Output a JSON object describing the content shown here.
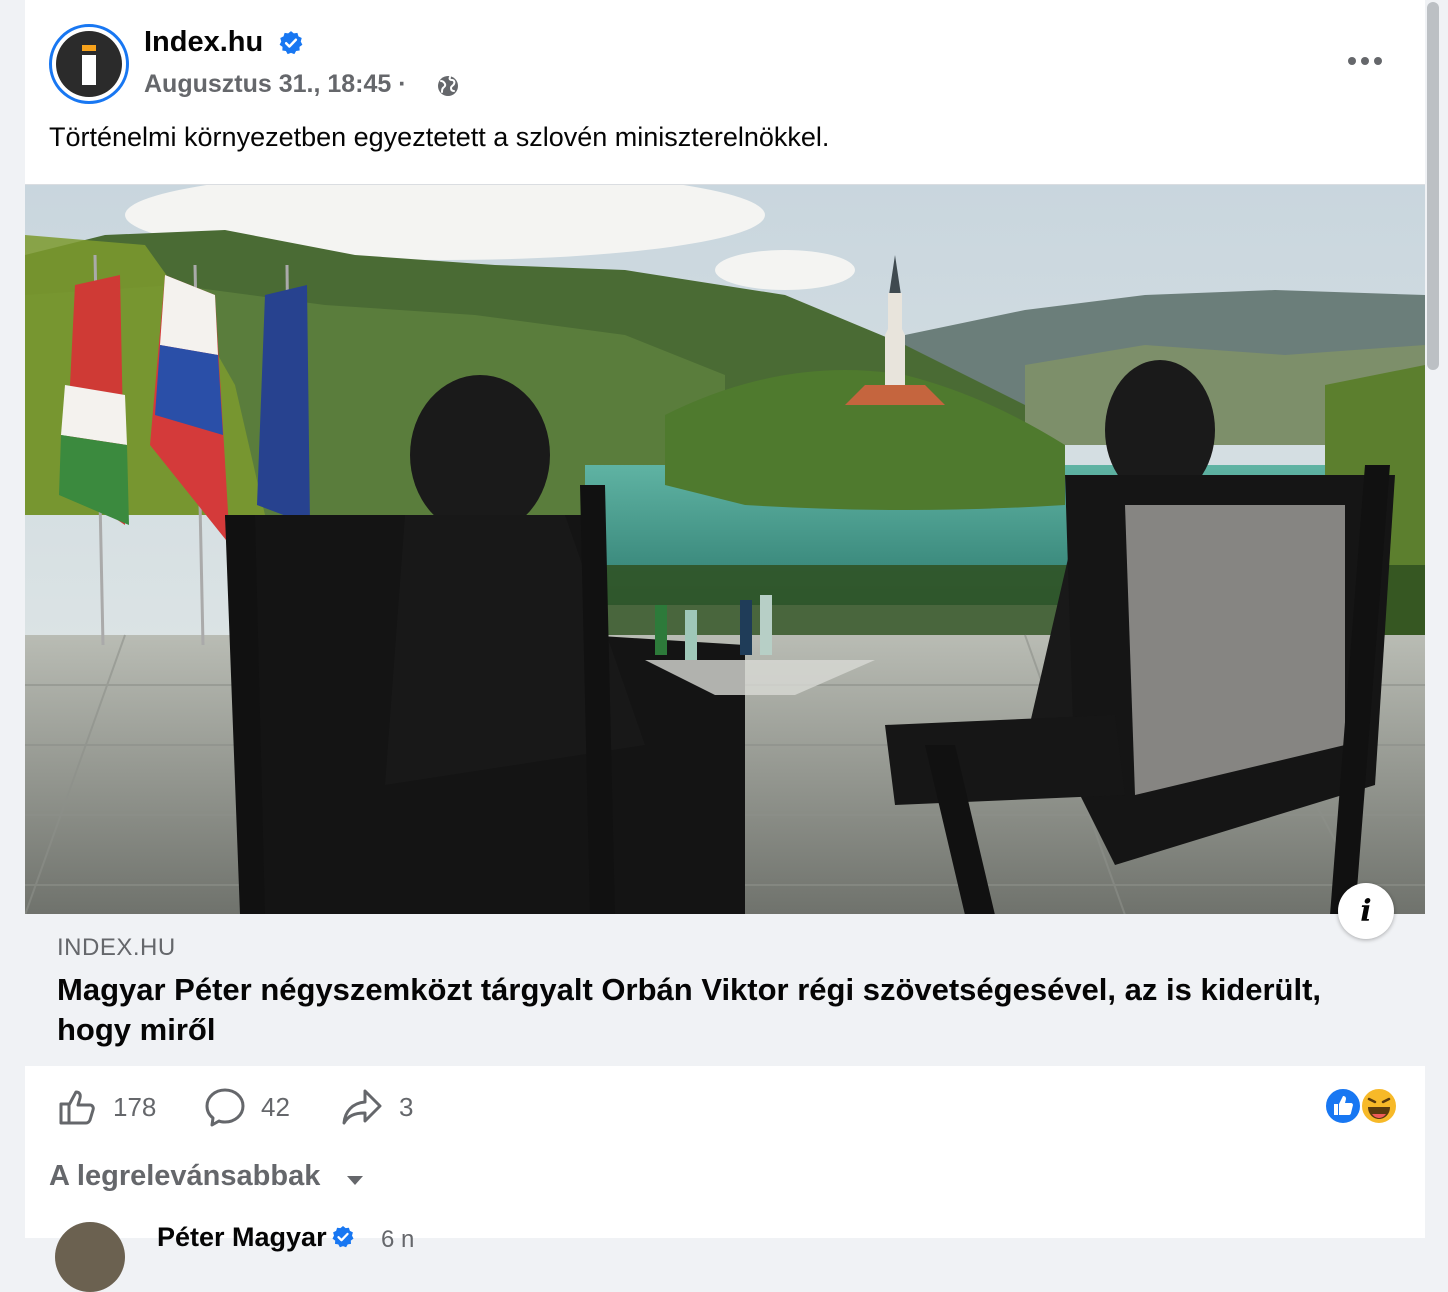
{
  "post": {
    "page_name": "Index.hu",
    "timestamp": "Augusztus 31., 18:45",
    "separator": "·",
    "text": "Történelmi környezetben egyeztetett a szlovén miniszterelnökkel."
  },
  "link_preview": {
    "domain": "INDEX.HU",
    "title": "Magyar Péter négyszemközt tárgyalt Orbán Viktor régi szövetségesével, az is kiderült, hogy miről",
    "info_glyph": "i"
  },
  "actions": {
    "likes": "178",
    "comments": "42",
    "shares": "3"
  },
  "comments_section": {
    "sort_label": "A legrelevánsabbak",
    "first_comment": {
      "author": "Péter Magyar",
      "time": "6 n"
    }
  },
  "icons": {
    "verified": "verified-badge-icon",
    "globe": "globe-icon",
    "more": "more-options-icon",
    "like": "thumbs-up-icon",
    "comment": "comment-bubble-icon",
    "share": "share-arrow-icon",
    "reactions": [
      "like-reaction-icon",
      "haha-reaction-icon"
    ]
  },
  "colors": {
    "brand_blue": "#1877f2",
    "secondary_text": "#65676b",
    "haha_yellow": "#f7b928"
  }
}
